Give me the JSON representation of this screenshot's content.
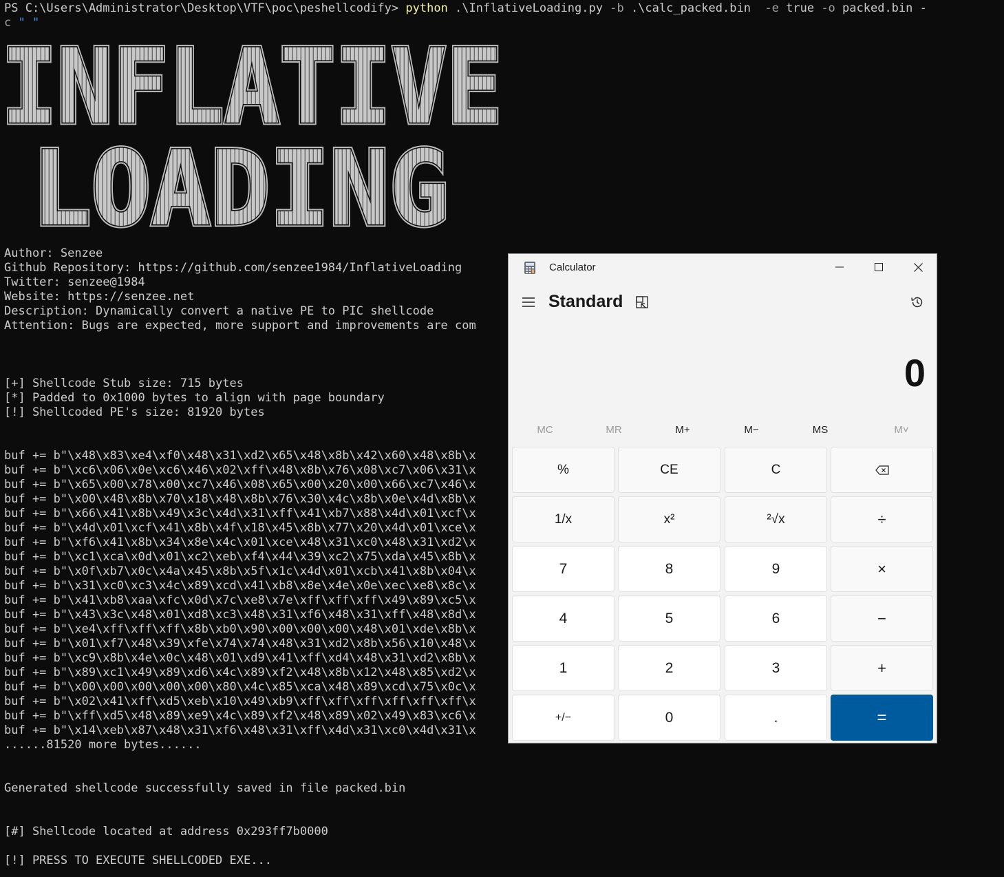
{
  "terminal": {
    "prompt": "PS C:\\Users\\Administrator\\Desktop\\VTF\\poc\\peshellcodify> ",
    "command": {
      "exe": "python",
      "script": " .\\InflativeLoading.py ",
      "flag_b": "-b",
      "arg_b": " .\\calc_packed.bin  ",
      "flag_e": "-e",
      "arg_e": " true ",
      "flag_o": "-o",
      "arg_o": " packed.bin -",
      "wrap_flag": "c",
      "wrap_arg": " \" \""
    },
    "banner": [
      "INFLATIVE",
      "LOADING"
    ],
    "info": [
      "Author: Senzee",
      "Github Repository: https://github.com/senzee1984/InflativeLoading",
      "Twitter: senzee@1984",
      "Website: https://senzee.net",
      "Description: Dynamically convert a native PE to PIC shellcode",
      "Attention: Bugs are expected, more support and improvements are com"
    ],
    "stats": [
      "[+] Shellcode Stub size: 715 bytes",
      "[*] Padded to 0x1000 bytes to align with page boundary",
      "[!] Shellcoded PE's size: 81920 bytes"
    ],
    "buf_lines": [
      "buf += b\"\\x48\\x83\\xe4\\xf0\\x48\\x31\\xd2\\x65\\x48\\x8b\\x42\\x60\\x48\\x8b\\x",
      "buf += b\"\\xc6\\x06\\x0e\\xc6\\x46\\x02\\xff\\x48\\x8b\\x76\\x08\\xc7\\x06\\x31\\x",
      "buf += b\"\\x65\\x00\\x78\\x00\\xc7\\x46\\x08\\x65\\x00\\x20\\x00\\x66\\xc7\\x46\\x",
      "buf += b\"\\x00\\x48\\x8b\\x70\\x18\\x48\\x8b\\x76\\x30\\x4c\\x8b\\x0e\\x4d\\x8b\\x",
      "buf += b\"\\x66\\x41\\x8b\\x49\\x3c\\x4d\\x31\\xff\\x41\\xb7\\x88\\x4d\\x01\\xcf\\x",
      "buf += b\"\\x4d\\x01\\xcf\\x41\\x8b\\x4f\\x18\\x45\\x8b\\x77\\x20\\x4d\\x01\\xce\\x",
      "buf += b\"\\xf6\\x41\\x8b\\x34\\x8e\\x4c\\x01\\xce\\x48\\x31\\xc0\\x48\\x31\\xd2\\x",
      "buf += b\"\\xc1\\xca\\x0d\\x01\\xc2\\xeb\\xf4\\x44\\x39\\xc2\\x75\\xda\\x45\\x8b\\x",
      "buf += b\"\\x0f\\xb7\\x0c\\x4a\\x45\\x8b\\x5f\\x1c\\x4d\\x01\\xcb\\x41\\x8b\\x04\\x",
      "buf += b\"\\x31\\xc0\\xc3\\x4c\\x89\\xcd\\x41\\xb8\\x8e\\x4e\\x0e\\xec\\xe8\\x8c\\x",
      "buf += b\"\\x41\\xb8\\xaa\\xfc\\x0d\\x7c\\xe8\\x7e\\xff\\xff\\xff\\x49\\x89\\xc5\\x",
      "buf += b\"\\x43\\x3c\\x48\\x01\\xd8\\xc3\\x48\\x31\\xf6\\x48\\x31\\xff\\x48\\x8d\\x",
      "buf += b\"\\xe4\\xff\\xff\\xff\\x8b\\xb0\\x90\\x00\\x00\\x00\\x48\\x01\\xde\\x8b\\x",
      "buf += b\"\\x01\\xf7\\x48\\x39\\xfe\\x74\\x74\\x48\\x31\\xd2\\x8b\\x56\\x10\\x48\\x",
      "buf += b\"\\xc9\\x8b\\x4e\\x0c\\x48\\x01\\xd9\\x41\\xff\\xd4\\x48\\x31\\xd2\\x8b\\x",
      "buf += b\"\\x89\\xc1\\x49\\x89\\xd6\\x4c\\x89\\xf2\\x48\\x8b\\x12\\x48\\x85\\xd2\\x",
      "buf += b\"\\x00\\x00\\x00\\x00\\x00\\x80\\x4c\\x85\\xca\\x48\\x89\\xcd\\x75\\x0c\\x",
      "buf += b\"\\x02\\x41\\xff\\xd5\\xeb\\x10\\x49\\xb9\\xff\\xff\\xff\\xff\\xff\\xff\\x",
      "buf += b\"\\xff\\xd5\\x48\\x89\\xe9\\x4c\\x89\\xf2\\x48\\x89\\x02\\x49\\x83\\xc6\\x",
      "buf += b\"\\x14\\xeb\\x87\\x48\\x31\\xf6\\x48\\x31\\xff\\x4d\\x31\\xc0\\x4d\\x31\\x"
    ],
    "more_bytes": "......81520 more bytes......",
    "saved": "Generated shellcode successfully saved in file packed.bin",
    "located": "[#] Shellcode located at address 0x293ff7b0000",
    "press": "[!] PRESS TO EXECUTE SHELLCODED EXE..."
  },
  "calculator": {
    "title": "Calculator",
    "mode": "Standard",
    "display": "0",
    "icons": {
      "app": "calculator-app-icon",
      "minimize": "minimize-icon",
      "maximize": "maximize-icon",
      "close": "close-icon",
      "menu": "hamburger-menu-icon",
      "keep_on_top": "keep-on-top-icon",
      "history": "history-icon"
    },
    "memory": [
      {
        "label": "MC",
        "enabled": false
      },
      {
        "label": "MR",
        "enabled": false
      },
      {
        "label": "M+",
        "enabled": true
      },
      {
        "label": "M−",
        "enabled": true
      },
      {
        "label": "MS",
        "enabled": true
      },
      {
        "label": "M˅",
        "enabled": false
      }
    ],
    "keys": [
      [
        "%",
        "CE",
        "C",
        "⌫"
      ],
      [
        "1/x",
        "x²",
        "²√x",
        "÷"
      ],
      [
        "7",
        "8",
        "9",
        "×"
      ],
      [
        "4",
        "5",
        "6",
        "−"
      ],
      [
        "1",
        "2",
        "3",
        "+"
      ],
      [
        "+/−",
        "0",
        ".",
        "="
      ]
    ],
    "colors": {
      "background": "#f3f3f3",
      "number_key": "#ffffff",
      "operator_key": "#f9f9f9",
      "accent": "#005a9e"
    }
  },
  "colors": {
    "terminal_bg": "#0c0c0c",
    "terminal_fg": "#cccccc",
    "command": "#f9f1a5",
    "string": "#3b8eea"
  }
}
